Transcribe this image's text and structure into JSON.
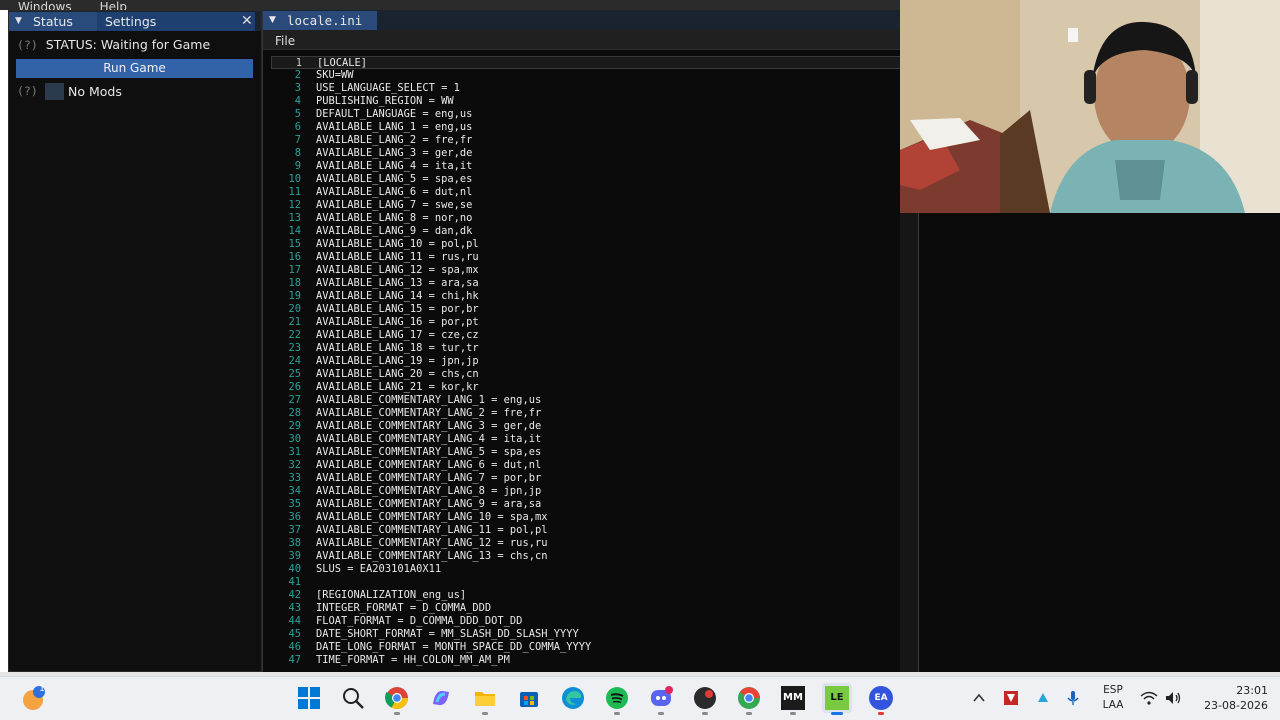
{
  "menubar": {
    "items": [
      "Windows",
      "Help"
    ]
  },
  "left_panel": {
    "tabs": {
      "status": "Status",
      "settings": "Settings"
    },
    "close_glyph": "✕",
    "help_mark": "(?)",
    "status_text": "STATUS: Waiting for Game",
    "run_button": "Run Game",
    "mods_label": "No Mods"
  },
  "editor": {
    "tab_label": "locale.ini",
    "menu_file": "File",
    "lines": [
      "[LOCALE]",
      "SKU=WW",
      "USE_LANGUAGE_SELECT = 1",
      "PUBLISHING_REGION = WW",
      "DEFAULT_LANGUAGE = eng,us",
      "AVAILABLE_LANG_1 = eng,us",
      "AVAILABLE_LANG_2 = fre,fr",
      "AVAILABLE_LANG_3 = ger,de",
      "AVAILABLE_LANG_4 = ita,it",
      "AVAILABLE_LANG_5 = spa,es",
      "AVAILABLE_LANG_6 = dut,nl",
      "AVAILABLE_LANG_7 = swe,se",
      "AVAILABLE_LANG_8 = nor,no",
      "AVAILABLE_LANG_9 = dan,dk",
      "AVAILABLE_LANG_10 = pol,pl",
      "AVAILABLE_LANG_11 = rus,ru",
      "AVAILABLE_LANG_12 = spa,mx",
      "AVAILABLE_LANG_13 = ara,sa",
      "AVAILABLE_LANG_14 = chi,hk",
      "AVAILABLE_LANG_15 = por,br",
      "AVAILABLE_LANG_16 = por,pt",
      "AVAILABLE_LANG_17 = cze,cz",
      "AVAILABLE_LANG_18 = tur,tr",
      "AVAILABLE_LANG_19 = jpn,jp",
      "AVAILABLE_LANG_20 = chs,cn",
      "AVAILABLE_LANG_21 = kor,kr",
      "AVAILABLE_COMMENTARY_LANG_1 = eng,us",
      "AVAILABLE_COMMENTARY_LANG_2 = fre,fr",
      "AVAILABLE_COMMENTARY_LANG_3 = ger,de",
      "AVAILABLE_COMMENTARY_LANG_4 = ita,it",
      "AVAILABLE_COMMENTARY_LANG_5 = spa,es",
      "AVAILABLE_COMMENTARY_LANG_6 = dut,nl",
      "AVAILABLE_COMMENTARY_LANG_7 = por,br",
      "AVAILABLE_COMMENTARY_LANG_8 = jpn,jp",
      "AVAILABLE_COMMENTARY_LANG_9 = ara,sa",
      "AVAILABLE_COMMENTARY_LANG_10 = spa,mx",
      "AVAILABLE_COMMENTARY_LANG_11 = pol,pl",
      "AVAILABLE_COMMENTARY_LANG_12 = rus,ru",
      "AVAILABLE_COMMENTARY_LANG_13 = chs,cn",
      "SLUS = EA203101A0X11",
      "",
      "[REGIONALIZATION_eng_us]",
      "INTEGER_FORMAT = D_COMMA_DDD",
      "FLOAT_FORMAT = D_COMMA_DDD_DOT_DD",
      "DATE_SHORT_FORMAT = MM_SLASH_DD_SLASH_YYYY",
      "DATE_LONG_FORMAT = MONTH_SPACE_DD_COMMA_YYYY",
      "TIME_FORMAT = HH_COLON_MM_AM_PM"
    ]
  },
  "taskbar": {
    "notification_badge": "1",
    "apps": [
      {
        "name": "windows-start",
        "color": "#0078d4"
      },
      {
        "name": "search",
        "color": "#333333"
      },
      {
        "name": "chrome",
        "color": "#db4437"
      },
      {
        "name": "copilot",
        "color": "#7b61ff"
      },
      {
        "name": "file-explorer",
        "color": "#f4b400"
      },
      {
        "name": "microsoft-store",
        "color": "#0a5fb4"
      },
      {
        "name": "edge",
        "color": "#0c8fd6"
      },
      {
        "name": "spotify",
        "color": "#1db954"
      },
      {
        "name": "discord",
        "color": "#5865f2"
      },
      {
        "name": "dark-app",
        "color": "#2b2b2b"
      },
      {
        "name": "chrome-alt",
        "color": "#34a853"
      },
      {
        "name": "mm-app",
        "color": "#1b1b1b"
      },
      {
        "name": "le-app",
        "color": "#7ac943"
      },
      {
        "name": "ea-app",
        "color": "#3355dd"
      }
    ],
    "mm_label": "MM",
    "le_label": "LE",
    "ea_label": "EA",
    "language": "ESP",
    "layout": "LAA",
    "time": "23:01",
    "date": "23-08-2026"
  }
}
